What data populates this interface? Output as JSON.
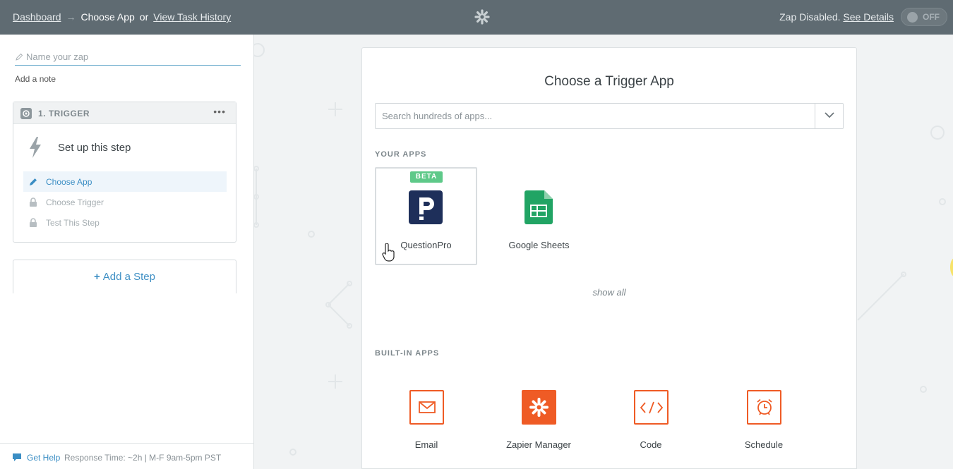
{
  "topbar": {
    "dashboard_link": "Dashboard",
    "arrow": "→",
    "current": "Choose App",
    "or": "or",
    "history_link": "View Task History",
    "status_text": "Zap Disabled.",
    "details_link": "See Details",
    "toggle_label": "OFF"
  },
  "sidebar": {
    "zap_name_placeholder": "Name your zap",
    "add_note": "Add a note",
    "trigger": {
      "title": "1. TRIGGER",
      "menu": "•••",
      "setup_text": "Set up this step",
      "steps": [
        {
          "label": "Choose App",
          "state": "active",
          "icon": "pencil-icon"
        },
        {
          "label": "Choose Trigger",
          "state": "locked",
          "icon": "lock-icon"
        },
        {
          "label": "Test This Step",
          "state": "locked",
          "icon": "lock-icon"
        }
      ]
    },
    "add_step": {
      "plus": "+",
      "label": "Add a Step"
    },
    "help": {
      "link": "Get Help",
      "info": "Response Time: ~2h | M-F 9am-5pm PST"
    }
  },
  "main": {
    "title": "Choose a Trigger App",
    "search_placeholder": "Search hundreds of apps...",
    "your_apps_label": "YOUR APPS",
    "your_apps": [
      {
        "name": "QuestionPro",
        "badge": "BETA",
        "icon": "questionpro-icon"
      },
      {
        "name": "Google Sheets",
        "icon": "google-sheets-icon"
      }
    ],
    "show_all": "show all",
    "builtin_label": "BUILT-IN APPS",
    "builtin_apps": [
      {
        "name": "Email",
        "icon": "email-icon"
      },
      {
        "name": "Zapier Manager",
        "icon": "zapier-manager-icon"
      },
      {
        "name": "Code",
        "icon": "code-icon"
      },
      {
        "name": "Schedule",
        "icon": "schedule-icon"
      }
    ]
  },
  "colors": {
    "topbar": "#5f6b72",
    "accent_blue": "#3b8ec4",
    "zapier_orange": "#ef5b25",
    "beta_green": "#5ec989",
    "questionpro_navy": "#1e2f5a",
    "sheets_green": "#21a464"
  }
}
